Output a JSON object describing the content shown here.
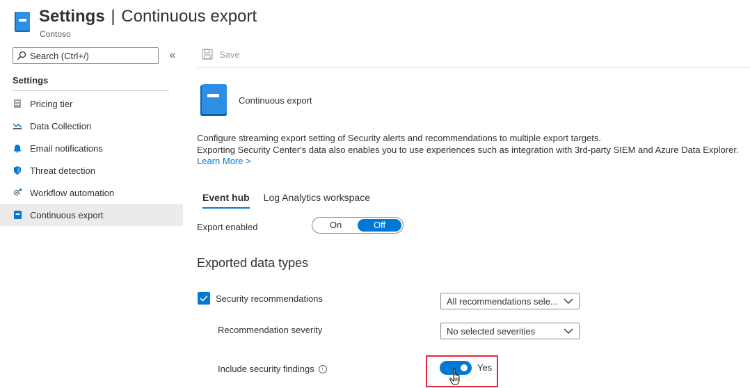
{
  "header": {
    "title_strong": "Settings",
    "separator": "|",
    "title_rest": "Continuous export",
    "subtitle": "Contoso"
  },
  "search": {
    "placeholder": "Search (Ctrl+/)"
  },
  "sidebar": {
    "collapse_glyph": "«",
    "section_title": "Settings",
    "items": [
      {
        "label": "Pricing tier",
        "icon": "pricing-tier-icon"
      },
      {
        "label": "Data Collection",
        "icon": "data-collection-icon"
      },
      {
        "label": "Email notifications",
        "icon": "bell-icon"
      },
      {
        "label": "Threat detection",
        "icon": "shield-icon"
      },
      {
        "label": "Workflow automation",
        "icon": "gear-icon"
      },
      {
        "label": "Continuous export",
        "icon": "continuous-export-icon",
        "active": true
      }
    ]
  },
  "toolbar": {
    "save_label": "Save"
  },
  "main": {
    "hero_label": "Continuous export",
    "description_line1": "Configure streaming export setting of Security alerts and recommendations to multiple export targets.",
    "description_line2": "Exporting Security Center's data also enables you to use experiences such as integration with 3rd-party SIEM and Azure Data Explorer.",
    "learn_more": "Learn More >",
    "tabs": [
      {
        "label": "Event hub",
        "active": true
      },
      {
        "label": "Log Analytics workspace",
        "active": false
      }
    ],
    "export_enabled": {
      "label": "Export enabled",
      "on_label": "On",
      "off_label": "Off",
      "selected": "Off"
    },
    "exported_data_types_title": "Exported data types",
    "security_recommendations": {
      "label": "Security recommendations",
      "checked": true,
      "dropdown_value": "All recommendations sele..."
    },
    "recommendation_severity": {
      "label": "Recommendation severity",
      "dropdown_value": "No selected severities"
    },
    "include_findings": {
      "label": "Include security findings",
      "info_glyph": "i",
      "toggle_value": "Yes",
      "enabled": true
    }
  },
  "colors": {
    "accent": "#0078d4",
    "highlight": "#e3283e",
    "active_bg": "#edebe9"
  }
}
